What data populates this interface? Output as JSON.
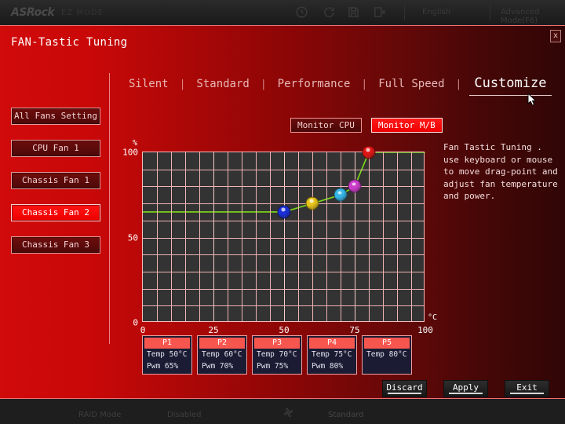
{
  "background_ui": {
    "logo": "ASRock",
    "mode_label": "EZ MODE",
    "language": "English",
    "advanced_mode": "Advanced Mode(F6)",
    "icons": [
      "clock-icon",
      "refresh-icon",
      "save-icon",
      "exit-icon"
    ],
    "status_left": "RAID Mode",
    "status_left_value": "Disabled",
    "status_right": "Standard"
  },
  "modal": {
    "title": "FAN-Tastic Tuning",
    "close_label": "x"
  },
  "tabs": [
    {
      "label": "Silent",
      "active": false
    },
    {
      "label": "Standard",
      "active": false
    },
    {
      "label": "Performance",
      "active": false
    },
    {
      "label": "Full Speed",
      "active": false
    },
    {
      "label": "Customize",
      "active": true
    }
  ],
  "sidebar": {
    "items": [
      {
        "label": "All Fans Setting",
        "active": false
      },
      {
        "label": "CPU Fan 1",
        "active": false
      },
      {
        "label": "Chassis Fan 1",
        "active": false
      },
      {
        "label": "Chassis Fan 2",
        "active": true
      },
      {
        "label": "Chassis Fan 3",
        "active": false
      }
    ]
  },
  "monitor_buttons": [
    {
      "label": "Monitor CPU",
      "active": false
    },
    {
      "label": "Monitor M/B",
      "active": true
    }
  ],
  "help": {
    "text": "Fan Tastic Tuning . use keyboard or mouse to move drag-point and adjust fan temperature and power."
  },
  "points": [
    {
      "name": "P1",
      "temp": "Temp 50°C",
      "pwm": "Pwm  65%",
      "color": "#1a2fd8"
    },
    {
      "name": "P2",
      "temp": "Temp 60°C",
      "pwm": "Pwm  70%",
      "color": "#e6c21a"
    },
    {
      "name": "P3",
      "temp": "Temp 70°C",
      "pwm": "Pwm  75%",
      "color": "#37b6e8"
    },
    {
      "name": "P4",
      "temp": "Temp 75°C",
      "pwm": "Pwm  80%",
      "color": "#cc3ccc"
    },
    {
      "name": "P5",
      "temp": "Temp 80°C",
      "pwm": "",
      "color": "#e01616"
    }
  ],
  "actions": [
    {
      "label": "Discard"
    },
    {
      "label": "Apply"
    },
    {
      "label": "Exit"
    }
  ],
  "chart_data": {
    "type": "line",
    "title": "",
    "xlabel": "°C",
    "ylabel": "%",
    "xlim": [
      0,
      100
    ],
    "ylim": [
      0,
      100
    ],
    "xticks": [
      0,
      25,
      50,
      75,
      100
    ],
    "xticklabels": [
      "0",
      "25",
      "50",
      "75",
      "100"
    ],
    "yticks": [
      0,
      50,
      100
    ],
    "yticklabels": [
      "0",
      "50",
      "100"
    ],
    "grid": true,
    "legend": "none",
    "line_color": "#7ddc17",
    "x": [
      0,
      50,
      60,
      70,
      75,
      80,
      100
    ],
    "y": [
      65,
      65,
      70,
      75,
      80,
      100,
      100
    ],
    "markers": [
      {
        "label": "P1",
        "x": 50,
        "y": 65,
        "color": "#1a2fd8"
      },
      {
        "label": "P2",
        "x": 60,
        "y": 70,
        "color": "#e6c21a"
      },
      {
        "label": "P3",
        "x": 70,
        "y": 75,
        "color": "#37b6e8"
      },
      {
        "label": "P4",
        "x": 75,
        "y": 80,
        "color": "#cc3ccc"
      },
      {
        "label": "P5",
        "x": 80,
        "y": 100,
        "color": "#e01616"
      }
    ]
  }
}
